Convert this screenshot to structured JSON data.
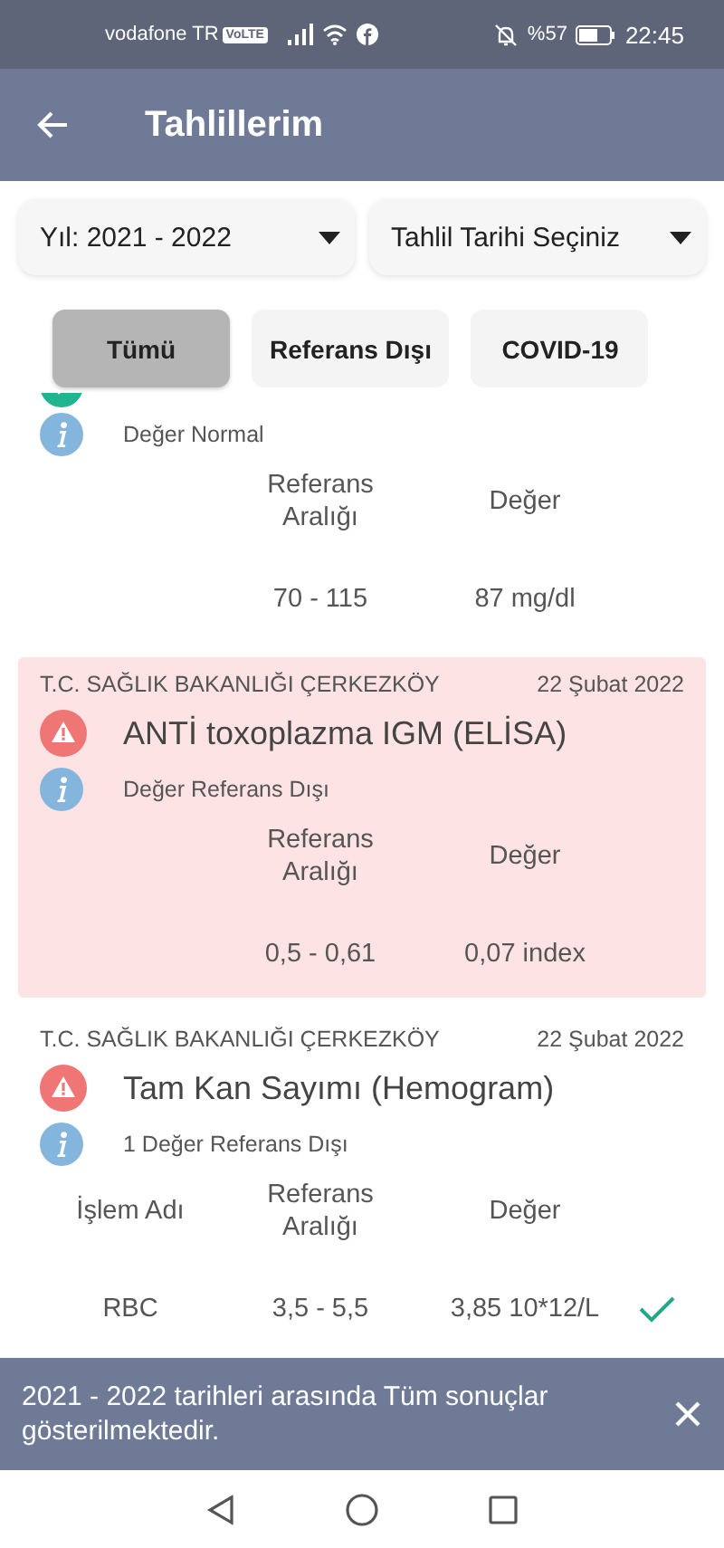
{
  "status_bar": {
    "carrier": "vodafone TR",
    "volte": "VoLTE",
    "battery": "%57",
    "time": "22:45"
  },
  "app_bar": {
    "title": "Tahlillerim"
  },
  "filters": [
    {
      "label": "Yıl: 2021 - 2022"
    },
    {
      "label": "Tahlil Tarihi Seçiniz"
    }
  ],
  "chips": [
    {
      "label": "Tümü",
      "selected": true
    },
    {
      "label": "Referans Dışı",
      "selected": false
    },
    {
      "label": "COVID-19",
      "selected": false
    }
  ],
  "results": [
    {
      "kind": "normal",
      "out_of_range": false,
      "note": "Değer Normal",
      "columns": [
        "Referans Aralığı",
        "Değer"
      ],
      "rows": [
        {
          "range": "70 - 115",
          "value": "87 mg/dl"
        }
      ]
    },
    {
      "source": "T.C. SAĞLIK BAKANLIĞI ÇERKEZKÖY",
      "date": "22 Şubat 2022",
      "kind": "warning",
      "out_of_range": true,
      "title": "ANTİ toxoplazma IGM (ELİSA)",
      "note": "Değer Referans Dışı",
      "columns": [
        "Referans Aralığı",
        "Değer"
      ],
      "rows": [
        {
          "range": "0,5 - 0,61",
          "value": "0,07 index"
        }
      ]
    },
    {
      "source": "T.C. SAĞLIK BAKANLIĞI ÇERKEZKÖY",
      "date": "22 Şubat 2022",
      "kind": "warning",
      "out_of_range": false,
      "title": "Tam Kan Sayımı (Hemogram)",
      "note": "1 Değer Referans Dışı",
      "columns": [
        "İşlem Adı",
        "Referans Aralığı",
        "Değer"
      ],
      "rows": [
        {
          "name": "RBC",
          "range": "3,5 - 5,5",
          "value": "3,85 10*12/L",
          "ok": true
        }
      ]
    }
  ],
  "snackbar": {
    "message": "2021 - 2022 tarihleri arasında Tüm sonuçlar gösterilmektedir."
  }
}
